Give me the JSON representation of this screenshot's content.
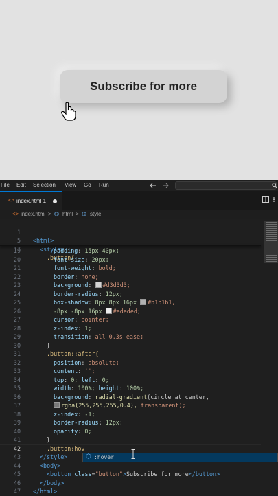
{
  "preview": {
    "button_label": "Subscribe for more"
  },
  "menubar": {
    "items": [
      "File",
      "Edit",
      "Selection",
      "View",
      "Go",
      "Run",
      "···"
    ],
    "back_icon": "arrow-left-icon",
    "forward_icon": "arrow-right-icon"
  },
  "tab": {
    "filename": "index.html 1",
    "icon": "html-file-icon",
    "modified": true
  },
  "breadcrumb": {
    "file": "index.html",
    "sep1": ">",
    "node1": "html",
    "sep2": ">",
    "node2": "style"
  },
  "colors": {
    "button_bg": "#d3d3d3",
    "shadow_dark": "#b1b1b1",
    "shadow_light": "#ededed",
    "editor_bg": "#1f1f1f",
    "accent": "#0078d4"
  },
  "editor": {
    "sticky": [
      {
        "ln": "1",
        "text": "<html>"
      },
      {
        "ln": "5",
        "text": "<style>"
      },
      {
        "ln": "17",
        "text": ".button{"
      }
    ],
    "lines": [
      {
        "ln": "19",
        "prop": "padding",
        "value": "15px 40px;"
      },
      {
        "ln": "20",
        "prop": "font-size",
        "value": "20px;"
      },
      {
        "ln": "21",
        "prop": "font-weight",
        "value": "bold;"
      },
      {
        "ln": "22",
        "prop": "border",
        "value": "none;"
      },
      {
        "ln": "23",
        "prop": "background",
        "value": "#d3d3d3;"
      },
      {
        "ln": "24",
        "prop": "border-radius",
        "value": "12px;"
      },
      {
        "ln": "25",
        "prop": "box-shadow",
        "value": "8px 8px 16px ",
        "value2": "#b1b1b1,"
      },
      {
        "ln": "26",
        "text_a": "-8px -8px 16px ",
        "text_b": "#ededed;"
      },
      {
        "ln": "27",
        "prop": "cursor",
        "value": "pointer;"
      },
      {
        "ln": "28",
        "prop": "z-index",
        "value": "1;"
      },
      {
        "ln": "29",
        "prop": "transition",
        "value": "all 0.3s ease;"
      },
      {
        "ln": "30",
        "text": "}"
      },
      {
        "ln": "31",
        "text": ".button::after{"
      },
      {
        "ln": "32",
        "prop": "position",
        "value": "absolute;"
      },
      {
        "ln": "33",
        "prop": "content",
        "value": "'';"
      },
      {
        "ln": "34",
        "prop": "top",
        "value": "0;",
        "prop2": "left",
        "value2": "0;"
      },
      {
        "ln": "35",
        "prop": "width",
        "value": "100%;",
        "prop2": "height",
        "value2": "100%;"
      },
      {
        "ln": "36",
        "prop": "background",
        "fn": "radial-gradient",
        "value": "(circle at center,"
      },
      {
        "ln": "37",
        "text_a": "rgba(255,255,255,0.4),",
        "text_b": " transparent);"
      },
      {
        "ln": "38",
        "prop": "z-index",
        "value": "-1;"
      },
      {
        "ln": "39",
        "prop": "border-radius",
        "value": "12px;"
      },
      {
        "ln": "40",
        "prop": "opacity",
        "value": "0;"
      },
      {
        "ln": "41",
        "text": "}"
      },
      {
        "ln": "42",
        "text": ".button:hov"
      },
      {
        "ln": "43",
        "text": "</style>"
      },
      {
        "ln": "44",
        "text": "<body>"
      },
      {
        "ln": "45",
        "tag_open": "<button ",
        "attr": "class",
        "attr_val": "\"button\"",
        "inner": "Subscribe for more",
        "tag_close": "</button>"
      },
      {
        "ln": "46",
        "text": "</body>"
      },
      {
        "ln": "47",
        "text": "</html>"
      }
    ],
    "suggestion": {
      "icon": "symbol-property-icon",
      "label": ":hover"
    }
  }
}
